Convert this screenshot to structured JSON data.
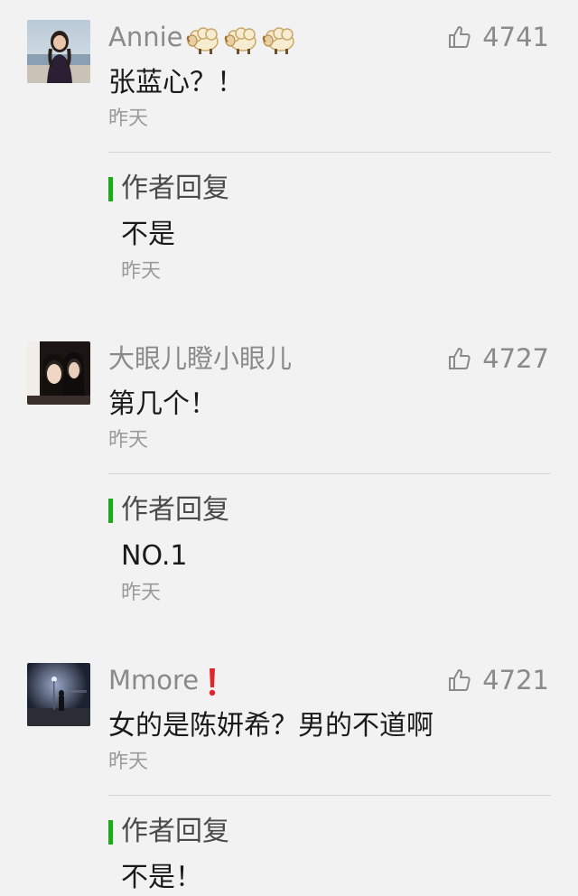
{
  "comments": [
    {
      "nickname": "Annie",
      "badge_icon": "sheep-emoji",
      "badge_count": 3,
      "likes": "4741",
      "content": "张蓝心？！",
      "time": "昨天",
      "reply_label": "作者回复",
      "reply_content": "不是",
      "reply_time": "昨天"
    },
    {
      "nickname": "大眼儿瞪小眼儿",
      "likes": "4727",
      "content": "第几个！",
      "time": "昨天",
      "reply_label": "作者回复",
      "reply_content": "NO.1",
      "reply_time": "昨天"
    },
    {
      "nickname": "Mmore",
      "badge_icon": "red-exclamation-emoji",
      "likes": "4721",
      "content": "女的是陈妍希？男的不道啊",
      "time": "昨天",
      "reply_label": "作者回复",
      "reply_content": "不是！"
    }
  ],
  "colors": {
    "background": "#f2f2f2",
    "reply_accent": "#1aad19",
    "nickname": "#8a8a8a",
    "exclamation": "#e0252b"
  }
}
